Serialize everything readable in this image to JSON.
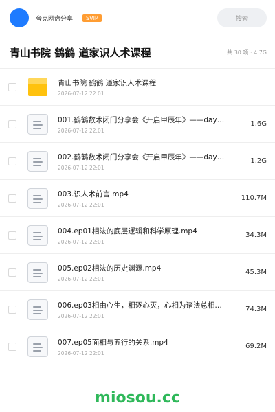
{
  "header": {
    "username": "夸克网盘分享",
    "badge": "SVIP",
    "search_label": "搜索"
  },
  "folder": {
    "title": "青山书院 鹤鹤 道家识人术课程",
    "meta": "共 30 项 · 4.7G"
  },
  "items": [
    {
      "type": "folder",
      "name": "青山书院 鹤鹤 道家识人术课程",
      "date": "2026-07-12 22:01",
      "size": ""
    },
    {
      "type": "file",
      "name": "001.鹤鹤数术闭门分享会《开启甲辰年》——day…",
      "date": "2026-07-12 22:01",
      "size": "1.6G"
    },
    {
      "type": "file",
      "name": "002.鹤鹤数术闭门分享会《开启甲辰年》——day…",
      "date": "2026-07-12 22:01",
      "size": "1.2G"
    },
    {
      "type": "file",
      "name": "003.识人术前言.mp4",
      "date": "2026-07-12 22:01",
      "size": "110.7M"
    },
    {
      "type": "file",
      "name": "004.ep01相法的底层逻辑和科学原理.mp4",
      "date": "2026-07-12 22:01",
      "size": "34.3M"
    },
    {
      "type": "file",
      "name": "005.ep02相法的历史渊源.mp4",
      "date": "2026-07-12 22:01",
      "size": "45.3M"
    },
    {
      "type": "file",
      "name": "006.ep03相由心生，相逐心灭，心相为诸法总相…",
      "date": "2026-07-12 22:01",
      "size": "74.3M"
    },
    {
      "type": "file",
      "name": "007.ep05面相与五行的关系.mp4",
      "date": "2026-07-12 22:01",
      "size": "69.2M"
    }
  ],
  "footer": {
    "watermark": "miosou.cc"
  },
  "colors": {
    "accent": "#1e7bff",
    "badge": "#ff9d33",
    "folder": "#ffc20e",
    "watermark": "#2fb85a"
  }
}
